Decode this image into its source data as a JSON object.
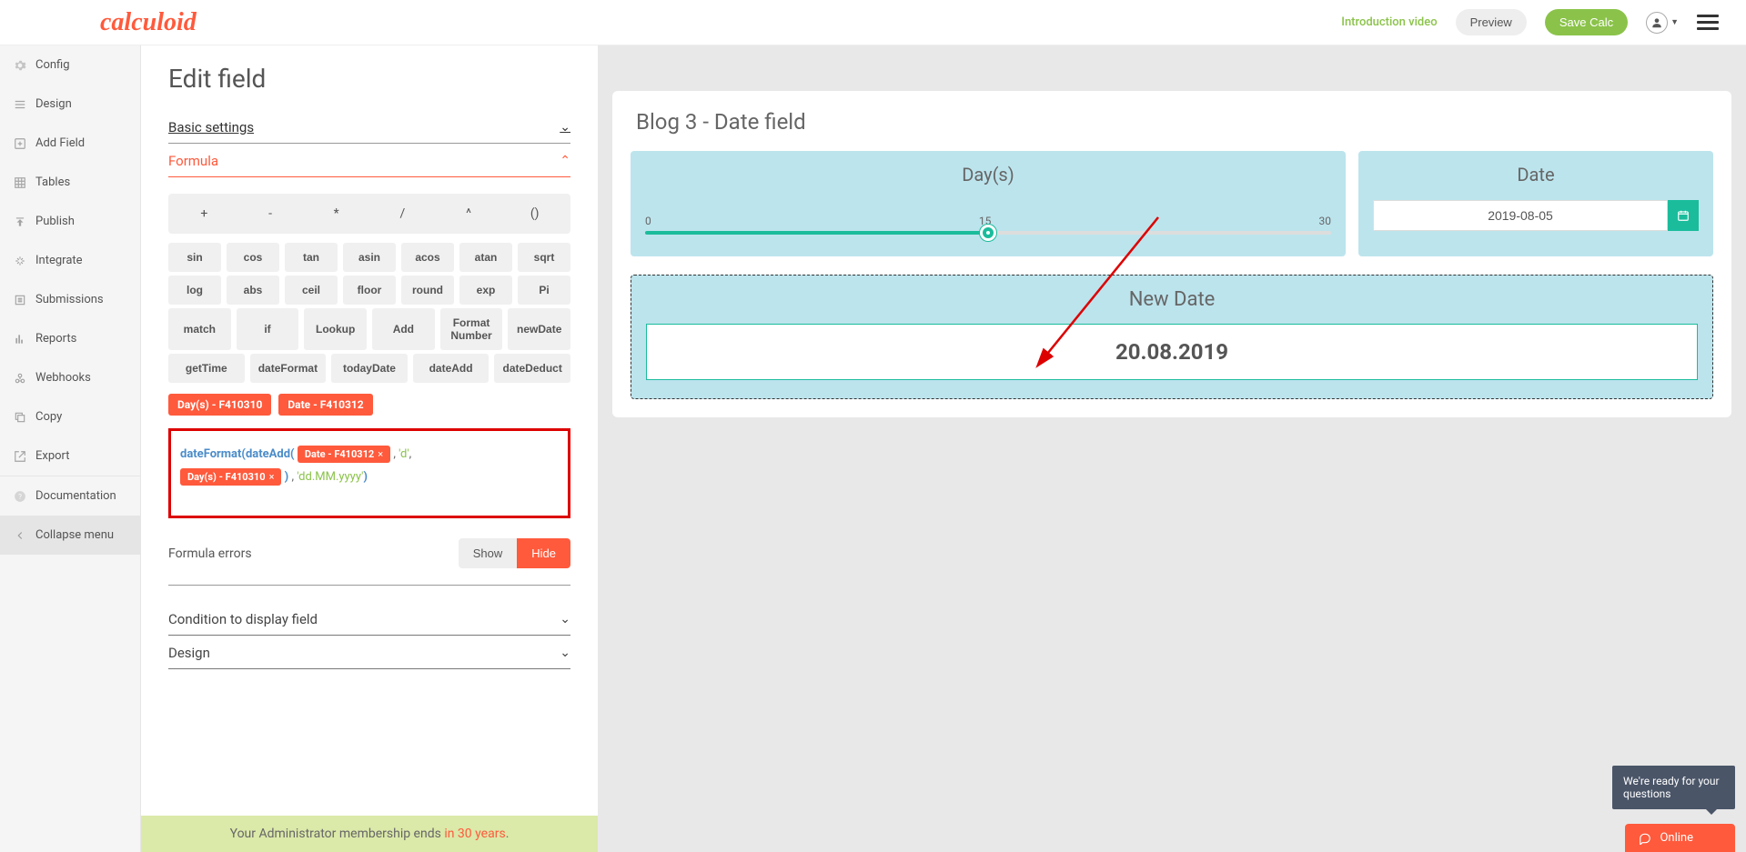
{
  "header": {
    "logo": "calculoid",
    "video_link": "Introduction video",
    "preview": "Preview",
    "save": "Save Calc"
  },
  "sidebar": [
    "Config",
    "Design",
    "Add Field",
    "Tables",
    "Publish",
    "Integrate",
    "Submissions",
    "Reports",
    "Webhooks",
    "Copy",
    "Export",
    "Documentation",
    "Collapse menu"
  ],
  "edit": {
    "title": "Edit field",
    "basic": "Basic settings",
    "formula": "Formula",
    "condition": "Condition to display field",
    "design": "Design",
    "operators": [
      "+",
      "-",
      "*",
      "/",
      "^",
      "()"
    ],
    "funcs": [
      [
        "sin",
        "cos",
        "tan",
        "asin",
        "acos",
        "atan",
        "sqrt"
      ],
      [
        "log",
        "abs",
        "ceil",
        "floor",
        "round",
        "exp",
        "Pi"
      ],
      [
        "match",
        "if",
        "Lookup",
        "Add",
        "Format Number",
        "newDate"
      ],
      [
        "getTime",
        "dateFormat",
        "todayDate",
        "dateAdd",
        "dateDeduct"
      ]
    ],
    "tags": [
      "Day(s) - F410310",
      "Date - F410312"
    ],
    "formula_parts": {
      "f1": "dateFormat",
      "f2": "dateAdd",
      "tagDate": "Date - F410312",
      "d": "'d'",
      "tagDays": "Day(s) - F410310",
      "fmt": "'dd.MM.yyyy'"
    },
    "errors_label": "Formula errors",
    "show": "Show",
    "hide": "Hide"
  },
  "preview": {
    "title": "Blog 3 - Date field",
    "days_label": "Day(s)",
    "slider_min": "0",
    "slider_mid": "15",
    "slider_max": "30",
    "date_label": "Date",
    "date_value": "2019-08-05",
    "newdate_label": "New Date",
    "newdate_value": "20.08.2019"
  },
  "footer": {
    "text": "Your Administrator membership ends ",
    "highlight": "in 30 years",
    "dot": "."
  },
  "chat": {
    "tooltip": "We're ready for your questions",
    "label": "Online"
  }
}
